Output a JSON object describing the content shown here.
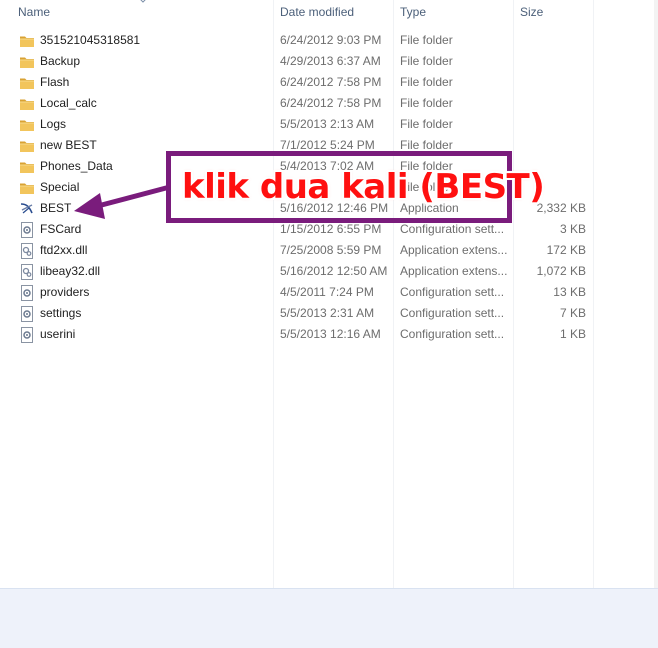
{
  "columns": {
    "name": "Name",
    "date": "Date modified",
    "type": "Type",
    "size": "Size"
  },
  "files": [
    {
      "name": "351521045318581",
      "date": "6/24/2012 9:03 PM",
      "type": "File folder",
      "size": "",
      "icon": "folder-icon"
    },
    {
      "name": "Backup",
      "date": "4/29/2013 6:37 AM",
      "type": "File folder",
      "size": "",
      "icon": "folder-icon"
    },
    {
      "name": "Flash",
      "date": "6/24/2012 7:58 PM",
      "type": "File folder",
      "size": "",
      "icon": "folder-icon"
    },
    {
      "name": "Local_calc",
      "date": "6/24/2012 7:58 PM",
      "type": "File folder",
      "size": "",
      "icon": "folder-icon"
    },
    {
      "name": "Logs",
      "date": "5/5/2013 2:13 AM",
      "type": "File folder",
      "size": "",
      "icon": "folder-icon"
    },
    {
      "name": "new BEST",
      "date": "7/1/2012 5:24 PM",
      "type": "File folder",
      "size": "",
      "icon": "folder-icon"
    },
    {
      "name": "Phones_Data",
      "date": "5/4/2013 7:02 AM",
      "type": "File folder",
      "size": "",
      "icon": "folder-icon"
    },
    {
      "name": "Special",
      "date": "",
      "type": "File folder",
      "size": "",
      "icon": "folder-icon"
    },
    {
      "name": "BEST",
      "date": "5/16/2012 12:46 PM",
      "type": "Application",
      "size": "2,332 KB",
      "icon": "application-icon"
    },
    {
      "name": "FSCard",
      "date": "1/15/2012 6:55 PM",
      "type": "Configuration sett...",
      "size": "3 KB",
      "icon": "settings-file-icon"
    },
    {
      "name": "ftd2xx.dll",
      "date": "7/25/2008 5:59 PM",
      "type": "Application extens...",
      "size": "172 KB",
      "icon": "dll-file-icon"
    },
    {
      "name": "libeay32.dll",
      "date": "5/16/2012 12:50 AM",
      "type": "Application extens...",
      "size": "1,072 KB",
      "icon": "dll-file-icon"
    },
    {
      "name": "providers",
      "date": "4/5/2011 7:24 PM",
      "type": "Configuration sett...",
      "size": "13 KB",
      "icon": "settings-file-icon"
    },
    {
      "name": "settings",
      "date": "5/5/2013 2:31 AM",
      "type": "Configuration sett...",
      "size": "7 KB",
      "icon": "settings-file-icon"
    },
    {
      "name": "userini",
      "date": "5/5/2013 12:16 AM",
      "type": "Configuration sett...",
      "size": "1 KB",
      "icon": "settings-file-icon"
    }
  ],
  "annotation": {
    "text": "klik dua kali (BEST)",
    "border_color": "#7a1c7c",
    "text_color": "#ff1010"
  },
  "colors": {
    "folder": "#e8b84a",
    "header_text": "#4c607a",
    "secondary_text": "#6d6d6d"
  }
}
